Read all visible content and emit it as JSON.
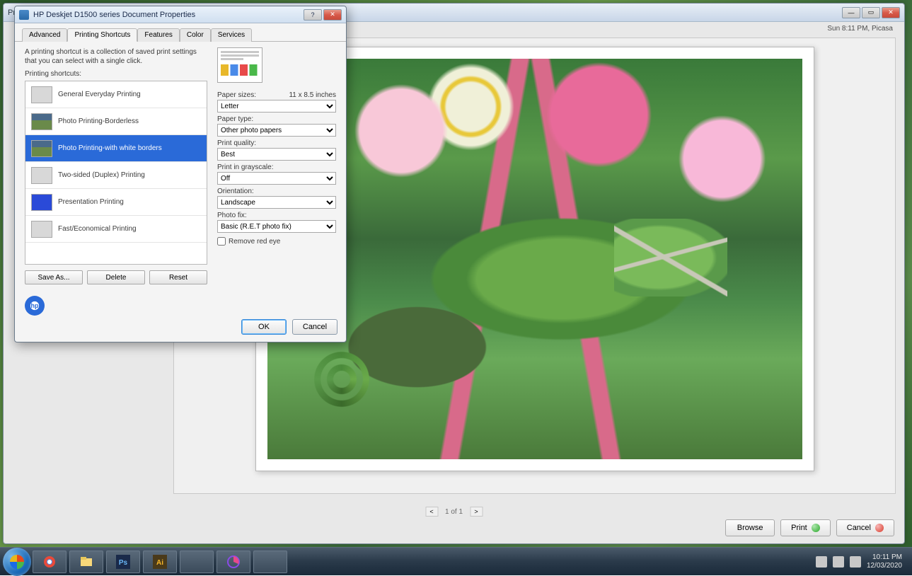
{
  "main_window": {
    "title": "Print Pictures",
    "top_right_text": "Sun 8:11 PM, Picasa",
    "pager": {
      "prev": "<",
      "label": "1 of 1",
      "next": ">"
    },
    "buttons": {
      "browse": "Browse",
      "print": "Print",
      "cancel": "Cancel"
    }
  },
  "dialog": {
    "title": "HP Deskjet D1500 series Document Properties",
    "tabs": [
      "Advanced",
      "Printing Shortcuts",
      "Features",
      "Color",
      "Services"
    ],
    "active_tab": 1,
    "desc": "A printing shortcut is a collection of saved print settings that you can select with a single click.",
    "list_label": "Printing shortcuts:",
    "shortcuts": [
      "General Everyday Printing",
      "Photo Printing-Borderless",
      "Photo Printing-with white borders",
      "Two-sided (Duplex) Printing",
      "Presentation Printing",
      "Fast/Economical Printing"
    ],
    "selected_shortcut": 2,
    "shortcut_buttons": {
      "save_as": "Save As...",
      "delete": "Delete",
      "reset": "Reset"
    },
    "settings": {
      "paper_sizes": {
        "label": "Paper sizes:",
        "dim": "11 x 8.5 inches",
        "value": "Letter"
      },
      "paper_type": {
        "label": "Paper type:",
        "value": "Other photo papers"
      },
      "print_quality": {
        "label": "Print quality:",
        "value": "Best"
      },
      "grayscale": {
        "label": "Print in grayscale:",
        "value": "Off"
      },
      "orientation": {
        "label": "Orientation:",
        "value": "Landscape"
      },
      "photo_fix": {
        "label": "Photo fix:",
        "value": "Basic (R.E.T photo fix)"
      },
      "red_eye": {
        "label": "Remove red eye",
        "checked": false
      }
    },
    "buttons": {
      "ok": "OK",
      "cancel": "Cancel"
    }
  },
  "taskbar": {
    "time": "10:11 PM",
    "date": "12/03/2020"
  }
}
